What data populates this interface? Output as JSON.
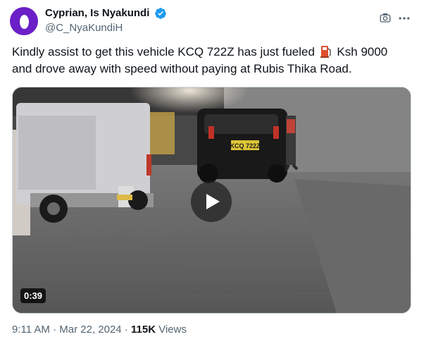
{
  "author": {
    "display_name": "Cyprian, Is Nyakundi",
    "handle": "@C_NyaKundiH",
    "verified_color": "#1d9bf0",
    "avatar_color": "#6a1fc7"
  },
  "header_icons": [
    "grok-icon",
    "more-icon"
  ],
  "tweet": {
    "line1_before": "Kindly assist to get this vehicle KCQ 722Z has just fueled",
    "line1_after": "Ksh 9000",
    "line2": "and drove away with speed without paying  at Rubis Thika Road.",
    "emoji": "fuel-pump"
  },
  "video": {
    "duration": "0:39",
    "plate_text": "KCQ 722Z"
  },
  "meta": {
    "time": "9:11 AM",
    "separator": "·",
    "date": "Mar 22, 2024",
    "views_count": "115K",
    "views_label": "Views"
  }
}
